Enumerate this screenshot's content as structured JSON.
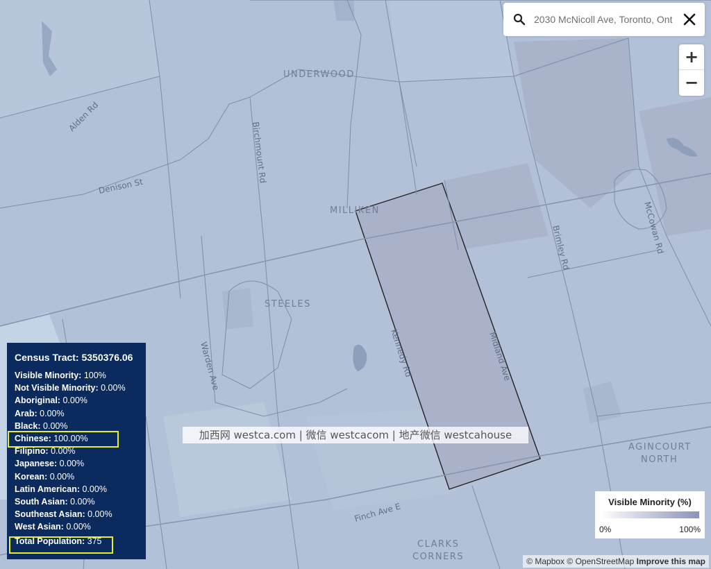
{
  "search": {
    "value": "2030 McNicoll Ave, Toronto, Ont"
  },
  "zoom": {
    "in_label": "+",
    "out_label": "−"
  },
  "map_labels": {
    "underwood": "UNDERWOOD",
    "milliken": "MILLIKEN",
    "steeles": "STEELES",
    "agincourt_north_1": "AGINCOURT",
    "agincourt_north_2": "NORTH",
    "clarks_corners_1": "CLARKS",
    "clarks_corners_2": "CORNERS"
  },
  "road_labels": {
    "alden": "Alden Rd",
    "denison": "Denison St",
    "birchmount": "Birchmount Rd",
    "warden": "Warden Ave",
    "kennedy": "Kennedy Rd",
    "midland": "Midland Ave",
    "brimley": "Brimley Rd",
    "mccowan": "McCowan Rd",
    "finch": "Finch Ave E"
  },
  "panel": {
    "title": "Census Tract: 5350376.06",
    "rows": [
      {
        "label": "Visible Minority:",
        "value": "100%"
      },
      {
        "label": "Not Visible Minority:",
        "value": "0.00%"
      },
      {
        "label": "Aboriginal:",
        "value": "0.00%"
      },
      {
        "label": "Arab:",
        "value": "0.00%"
      },
      {
        "label": "Black:",
        "value": "0.00%"
      },
      {
        "label": "Chinese:",
        "value": "100.00%"
      },
      {
        "label": "Filipino:",
        "value": "0.00%"
      },
      {
        "label": "Japanese:",
        "value": "0.00%"
      },
      {
        "label": "Korean:",
        "value": "0.00%"
      },
      {
        "label": "Latin American:",
        "value": "0.00%"
      },
      {
        "label": "South Asian:",
        "value": "0.00%"
      },
      {
        "label": "Southeast Asian:",
        "value": "0.00%"
      },
      {
        "label": "West Asian:",
        "value": "0.00%"
      }
    ],
    "total_label": "Total Population:",
    "total_value": "375"
  },
  "legend": {
    "title": "Visible Minority (%)",
    "min_label": "0%",
    "max_label": "100%",
    "color_low": "#ffffff",
    "color_high": "#8b93b8"
  },
  "watermark": "加西网 westca.com | 微信 westcacom | 地产微信 westcahouse",
  "attribution": {
    "mapbox": "© Mapbox",
    "osm": "© OpenStreetMap",
    "improve": "Improve this map"
  },
  "colors": {
    "map_fill": "#b3c1d8",
    "light_tract": "#c4d3e6",
    "selected_tract": "#aab2c9",
    "panel_bg": "#0b2a5e",
    "highlight": "#e8ee2a"
  }
}
